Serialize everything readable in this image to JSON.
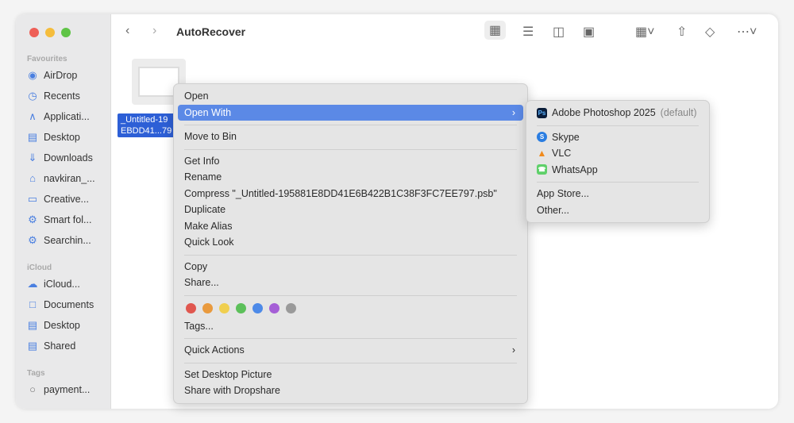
{
  "window": {
    "title": "AutoRecover"
  },
  "sidebar": {
    "favourites_label": "Favourites",
    "favourites": [
      {
        "label": "AirDrop",
        "icon": "airdrop-icon"
      },
      {
        "label": "Recents",
        "icon": "clock-icon"
      },
      {
        "label": "Applicati...",
        "icon": "applications-icon"
      },
      {
        "label": "Desktop",
        "icon": "desktop-icon"
      },
      {
        "label": "Downloads",
        "icon": "download-icon"
      },
      {
        "label": "navkiran_...",
        "icon": "home-icon"
      },
      {
        "label": "Creative...",
        "icon": "folder-icon"
      },
      {
        "label": "Smart fol...",
        "icon": "gear-icon"
      },
      {
        "label": "Searchin...",
        "icon": "gear-icon"
      }
    ],
    "icloud_label": "iCloud",
    "icloud": [
      {
        "label": "iCloud...",
        "icon": "cloud-icon"
      },
      {
        "label": "Documents",
        "icon": "document-icon"
      },
      {
        "label": "Desktop",
        "icon": "desktop-icon"
      },
      {
        "label": "Shared",
        "icon": "shared-folder-icon"
      }
    ],
    "tags_label": "Tags",
    "tags": [
      {
        "label": "payment...",
        "icon": "tag-circle-icon"
      }
    ]
  },
  "file": {
    "name_line1": "_Untitled-19",
    "name_line2": "EBDD41...79"
  },
  "context_menu": {
    "open": "Open",
    "open_with": "Open With",
    "move_to_bin": "Move to Bin",
    "get_info": "Get Info",
    "rename": "Rename",
    "compress": "Compress \"_Untitled-195881E8DD41E6B422B1C38F3FC7EE797.psb\"",
    "duplicate": "Duplicate",
    "make_alias": "Make Alias",
    "quick_look": "Quick Look",
    "copy": "Copy",
    "share": "Share...",
    "tag_colors": [
      "#e0574f",
      "#e99a3e",
      "#f0cf4f",
      "#5cc05a",
      "#4d8ae8",
      "#a55fd6",
      "#9a9a9a"
    ],
    "tags": "Tags...",
    "quick_actions": "Quick Actions",
    "set_desktop_picture": "Set Desktop Picture",
    "share_dropshare": "Share with Dropshare"
  },
  "submenu": {
    "photoshop": "Adobe Photoshop 2025",
    "default": "(default)",
    "skype": "Skype",
    "vlc": "VLC",
    "whatsapp": "WhatsApp",
    "app_store": "App Store...",
    "other": "Other..."
  },
  "colors": {
    "highlight": "#5b89e6",
    "selection": "#2d5fd6"
  }
}
